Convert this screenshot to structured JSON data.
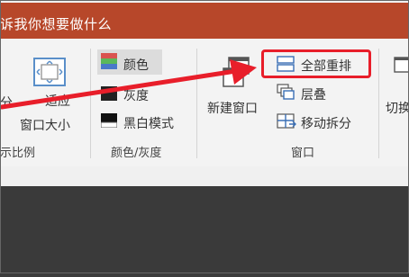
{
  "titlebar": {
    "tell_me": "诉我你想要做什么"
  },
  "zoom_group": {
    "partial_button_label": "分",
    "fit_window_label_1": "适应",
    "fit_window_label_2": "窗口大小",
    "group_label": "示比例"
  },
  "color_group": {
    "color_label": "颜色",
    "grayscale_label": "灰度",
    "bw_label": "黑白模式",
    "group_label": "颜色/灰度"
  },
  "window_group": {
    "new_window_label": "新建窗口",
    "arrange_all_label": "全部重排",
    "cascade_label": "层叠",
    "move_split_label": "移动拆分",
    "group_label": "窗口"
  },
  "switch_group": {
    "switch_label": "切换"
  },
  "colors": {
    "title_bg": "#b7472a",
    "ribbon_bg": "#f3f3f3",
    "highlight": "#e81e2a",
    "arrow": "#e81e2a",
    "dark_bg": "#3a3a3a"
  }
}
